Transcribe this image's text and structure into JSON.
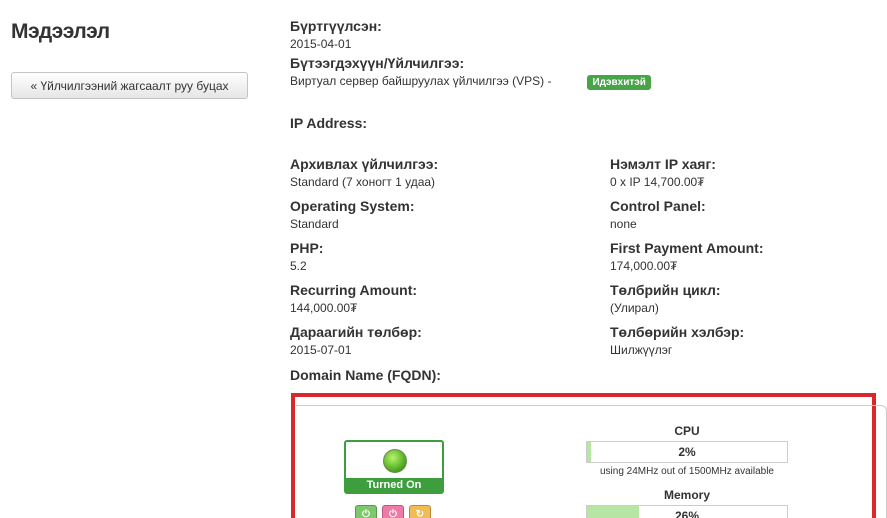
{
  "sidebar": {
    "title": "Мэдээлэл",
    "back_button": "« Үйлчилгээний жагсаалт руу буцах"
  },
  "details": {
    "registered_label": "Бүртгүүлсэн:",
    "registered_value": "2015-04-01",
    "product_label": "Бүтээгдэхүүн/Үйлчилгээ:",
    "product_value": "Виртуал сервер байшруулах үйлчилгээ (VPS) -",
    "status_badge": "Идэвхитэй",
    "ip_label": "IP Address:",
    "backup_label": "Архивлах үйлчилгээ:",
    "backup_value": "Standard (7 хоногт 1 удаа)",
    "extra_ip_label": "Нэмэлт IP хаяг:",
    "extra_ip_value": "0 x IP 14,700.00₮",
    "os_label": "Operating System:",
    "os_value": "Standard",
    "panel_label": "Control Panel:",
    "panel_value": "none",
    "php_label": "PHP:",
    "php_value": "5.2",
    "first_payment_label": "First Payment Amount:",
    "first_payment_value": "174,000.00₮",
    "recurring_label": "Recurring Amount:",
    "recurring_value": "144,000.00₮",
    "cycle_label": "Төлбрийн цикл:",
    "cycle_value": "(Улирал)",
    "next_due_label": "Дараагийн төлбөр:",
    "next_due_value": "2015-07-01",
    "payment_method_label": "Төлбөрийн хэлбэр:",
    "payment_method_value": "Шилжүүлэг",
    "domain_label": "Domain Name (FQDN):"
  },
  "vps_panel": {
    "status_text": "Turned On",
    "status_color": "#3e9e3e",
    "controls": [
      "power-on-icon",
      "power-off-icon",
      "reboot-icon"
    ],
    "cpu_title": "CPU",
    "cpu_percent_text": "2%",
    "cpu_percent": 2,
    "cpu_note": "using 24MHz out of 1500MHz available",
    "memory_title": "Memory",
    "memory_percent_text": "26%",
    "memory_percent": 26
  },
  "colors": {
    "highlight_frame": "#d9272e",
    "badge": "#47a447",
    "bar_fill": "#b7e6a4"
  }
}
